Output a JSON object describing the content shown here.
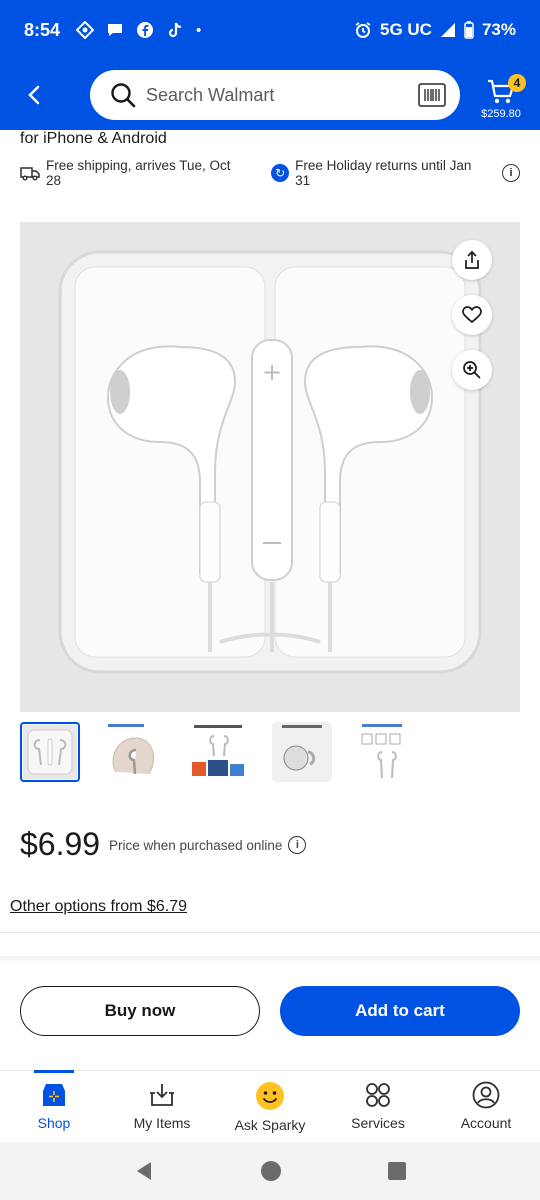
{
  "status_bar": {
    "time": "8:54",
    "network": "5G UC",
    "battery": "73%"
  },
  "header": {
    "search_placeholder": "Search Walmart",
    "cart_count": "4",
    "cart_total": "$259.80"
  },
  "product": {
    "title_tail": "for iPhone & Android",
    "shipping": "Free shipping, arrives Tue, Oct 28",
    "returns": "Free Holiday returns until Jan 31",
    "price": "$6.99",
    "price_note": "Price when purchased online",
    "other_options": "Other options from $6.79",
    "thumbnail_count": 5
  },
  "actions": {
    "buy_now": "Buy now",
    "add_to_cart": "Add to cart"
  },
  "bottom_nav": {
    "items": [
      {
        "label": "Shop",
        "icon": "shop-icon",
        "active": true
      },
      {
        "label": "My Items",
        "icon": "my-items-icon",
        "active": false
      },
      {
        "label": "Ask Sparky",
        "icon": "sparky-icon",
        "active": false
      },
      {
        "label": "Services",
        "icon": "services-icon",
        "active": false
      },
      {
        "label": "Account",
        "icon": "account-icon",
        "active": false
      }
    ]
  },
  "colors": {
    "brand_blue": "#0053e2",
    "spark_yellow": "#ffc220"
  }
}
